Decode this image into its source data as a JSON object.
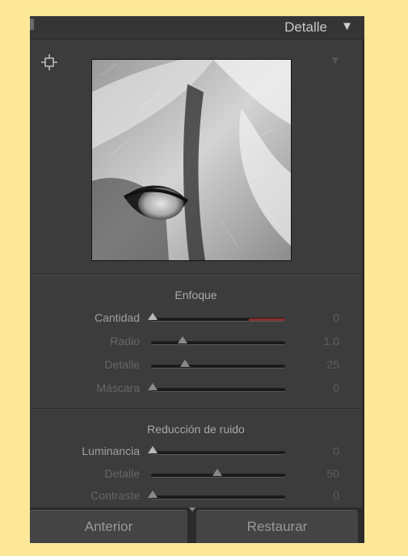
{
  "header": {
    "title": "Detalle"
  },
  "enfoque": {
    "title": "Enfoque",
    "rows": [
      {
        "label": "Cantidad",
        "value": "0",
        "fraction": 0.0
      },
      {
        "label": "Radio",
        "value": "1.0",
        "fraction": 0.23
      },
      {
        "label": "Detalle",
        "value": "25",
        "fraction": 0.25
      },
      {
        "label": "Máscara",
        "value": "0",
        "fraction": 0.0
      }
    ]
  },
  "ruido": {
    "title": "Reducción de ruido",
    "rows": [
      {
        "label": "Luminancia",
        "value": "0",
        "fraction": 0.0
      },
      {
        "label": "Detalle",
        "value": "50",
        "fraction": 0.5
      },
      {
        "label": "Contraste",
        "value": "0",
        "fraction": 0.0
      }
    ]
  },
  "footer": {
    "prev_label": "Anterior",
    "reset_label": "Restaurar"
  },
  "icons": {
    "target": "target-adjust-icon",
    "collapse": "triangle-down-icon"
  }
}
